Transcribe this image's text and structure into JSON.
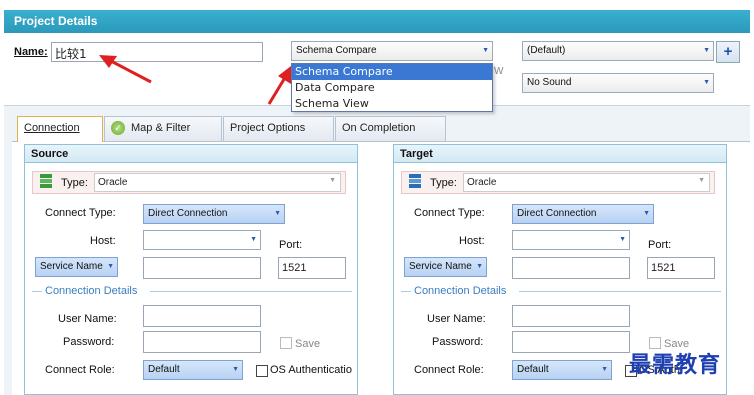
{
  "header": {
    "title": "Project Details"
  },
  "name": {
    "label": "Name:",
    "value": "比较1"
  },
  "compare_type": {
    "selected": "Schema Compare",
    "options": [
      "Schema Compare",
      "Data Compare",
      "Schema View"
    ]
  },
  "options_combo": {
    "value": "(Default)"
  },
  "sound_combo": {
    "value": "No Sound"
  },
  "hidden_label_fragment": "W",
  "tabs": [
    "Connection",
    "Map & Filter",
    "Project Options",
    "On Completion"
  ],
  "source": {
    "title": "Source",
    "type_label": "Type:",
    "type_value": "Oracle",
    "connect_type_label": "Connect Type:",
    "connect_type_value": "Direct Connection",
    "host_label": "Host:",
    "host_value": "",
    "port_label": "Port:",
    "port_value": "1521",
    "service_mode": "Service Name",
    "service_value": "",
    "conn_details": "Connection Details",
    "user_label": "User Name:",
    "user_value": "",
    "password_label": "Password:",
    "password_value": "",
    "save_label": "Save",
    "role_label": "Connect Role:",
    "role_value": "Default",
    "os_auth": "OS Authenticatio"
  },
  "target": {
    "title": "Target",
    "type_label": "Type:",
    "type_value": "Oracle",
    "connect_type_label": "Connect Type:",
    "connect_type_value": "Direct Connection",
    "host_label": "Host:",
    "host_value": "",
    "port_label": "Port:",
    "port_value": "1521",
    "service_mode": "Service Name",
    "service_value": "",
    "conn_details": "Connection Details",
    "user_label": "User Name:",
    "user_value": "",
    "password_label": "Password:",
    "password_value": "",
    "save_label": "Save",
    "role_label": "Connect Role:",
    "role_value": "Default",
    "os_auth": "OS Auth"
  },
  "watermark": "最需教育",
  "colors": {
    "header": "#2fa6c7",
    "arrow": "#e02020",
    "selection": "#3a78d4"
  }
}
